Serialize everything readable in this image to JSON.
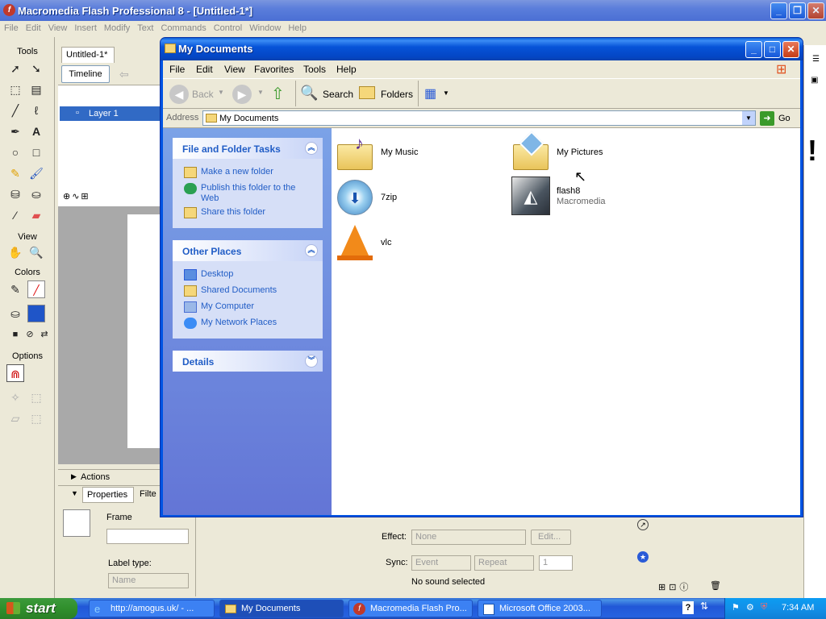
{
  "flash": {
    "title": "Macromedia Flash Professional 8 - [Untitled-1*]",
    "menu": [
      "File",
      "Edit",
      "View",
      "Insert",
      "Modify",
      "Text",
      "Commands",
      "Control",
      "Window",
      "Help"
    ],
    "tools_label": "Tools",
    "view_label": "View",
    "colors_label": "Colors",
    "options_label": "Options",
    "doc_tab": "Untitled-1*",
    "timeline_btn": "Timeline",
    "layer_name": "Layer 1",
    "actions_label": "Actions",
    "properties_tab": "Properties",
    "filters_tab": "Filte",
    "frame_label": "Frame",
    "label_type": "Label type:",
    "label_type_value": "Name",
    "effect_label": "Effect:",
    "effect_value": "None",
    "edit_btn": "Edit...",
    "sync_label": "Sync:",
    "sync_value": "Event",
    "repeat_value": "Repeat",
    "repeat_count": "1",
    "no_sound": "No sound selected",
    "right_char": "!"
  },
  "explorer": {
    "title": "My Documents",
    "menu": [
      "File",
      "Edit",
      "View",
      "Favorites",
      "Tools",
      "Help"
    ],
    "toolbar": {
      "back": "Back",
      "search": "Search",
      "folders": "Folders"
    },
    "address_label": "Address",
    "address_value": "My Documents",
    "go_label": "Go",
    "tasks": {
      "file_folder_title": "File and Folder Tasks",
      "file_folder_links": [
        "Make a new folder",
        "Publish this folder to the Web",
        "Share this folder"
      ],
      "other_places_title": "Other Places",
      "other_places_links": [
        "Desktop",
        "Shared Documents",
        "My Computer",
        "My Network Places"
      ],
      "details_title": "Details"
    },
    "items": [
      {
        "name": "My Music",
        "icon": "music-folder-icon"
      },
      {
        "name": "My Pictures",
        "icon": "pictures-folder-icon"
      },
      {
        "name": "7zip",
        "icon": "install-disc-icon"
      },
      {
        "name": "flash8",
        "sub": "Macromedia",
        "icon": "flash-shortcut-icon"
      },
      {
        "name": "vlc",
        "icon": "vlc-cone-icon"
      }
    ]
  },
  "taskbar": {
    "start": "start",
    "tasks": [
      "http://amogus.uk/ - ...",
      "My Documents",
      "Macromedia Flash Pro...",
      "Microsoft Office 2003..."
    ],
    "clock": "7:34 AM"
  },
  "colors": {
    "xp_blue": "#0054e3",
    "task_link": "#215dc6",
    "start_green": "#308f2c"
  }
}
